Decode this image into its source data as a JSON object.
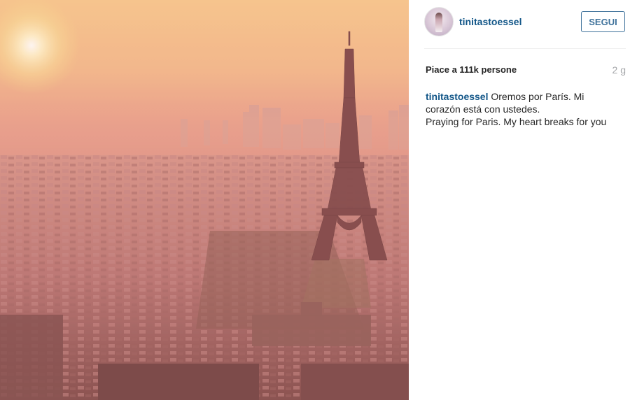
{
  "post": {
    "username": "tinitastoessel",
    "follow_label": "SEGUI",
    "likes_text": "Piace a 111k persone",
    "time_ago": "2 g",
    "caption": {
      "user": "tinitastoessel",
      "line1": "Oremos por París. Mi",
      "line2": "corazón está con ustedes.",
      "line3": "Praying for Paris. My heart breaks for you"
    }
  },
  "colors": {
    "link_blue": "#125688",
    "button_blue": "#3f729b",
    "muted_gray": "#a5a7aa"
  },
  "icons": {
    "avatar": "profile-photo",
    "photo": "eiffel-tower-sunset-photo"
  }
}
